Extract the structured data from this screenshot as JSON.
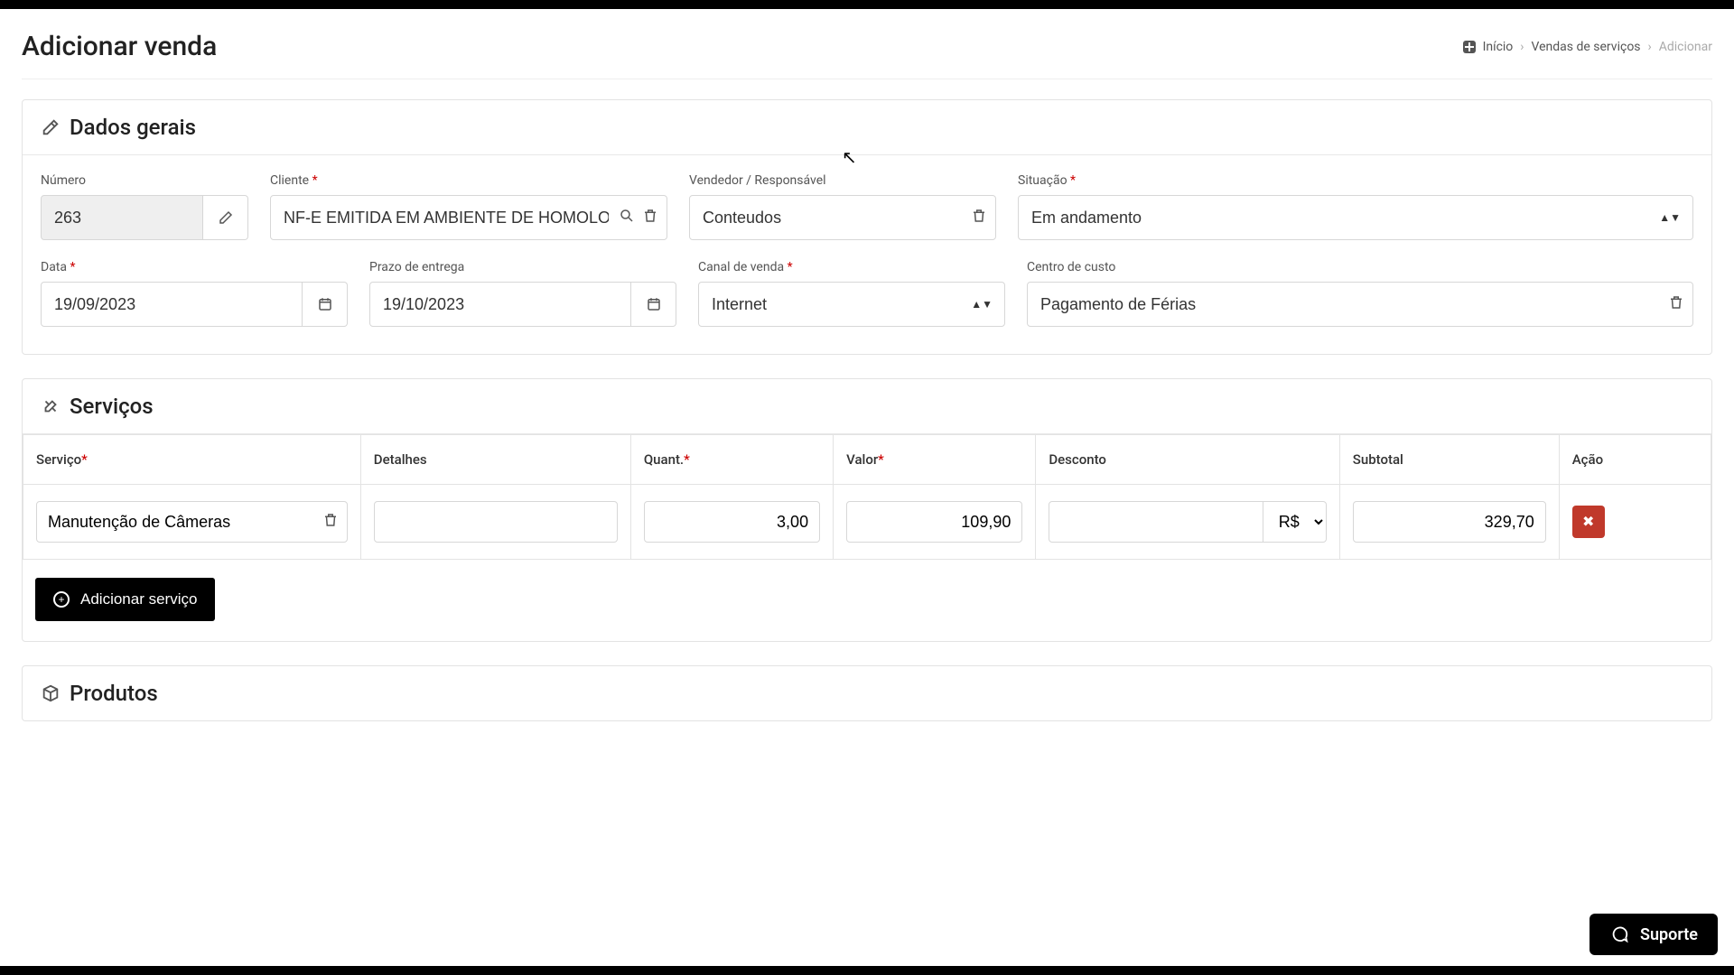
{
  "header": {
    "title": "Adicionar venda",
    "breadcrumb": {
      "home": "Início",
      "section": "Vendas de serviços",
      "current": "Adicionar"
    }
  },
  "panels": {
    "general": {
      "title": "Dados gerais"
    },
    "services": {
      "title": "Serviços"
    },
    "products": {
      "title": "Produtos"
    }
  },
  "fields": {
    "numero": {
      "label": "Número",
      "value": "263"
    },
    "cliente": {
      "label": "Cliente",
      "required": "*",
      "value": "NF-E EMITIDA EM AMBIENTE DE HOMOLOGAÇÃO"
    },
    "vendedor": {
      "label": "Vendedor / Responsável",
      "value": "Conteudos"
    },
    "situacao": {
      "label": "Situação",
      "required": "*",
      "value": "Em andamento"
    },
    "data": {
      "label": "Data",
      "required": "*",
      "value": "19/09/2023"
    },
    "prazo": {
      "label": "Prazo de entrega",
      "value": "19/10/2023"
    },
    "canal": {
      "label": "Canal de venda",
      "required": "*",
      "value": "Internet"
    },
    "centro": {
      "label": "Centro de custo",
      "value": "Pagamento de Férias"
    }
  },
  "services_table": {
    "headers": {
      "servico": "Serviço",
      "servico_req": "*",
      "detalhes": "Detalhes",
      "quant": "Quant.",
      "quant_req": "*",
      "valor": "Valor",
      "valor_req": "*",
      "desconto": "Desconto",
      "subtotal": "Subtotal",
      "acao": "Ação"
    },
    "rows": [
      {
        "servico": "Manutenção de Câmeras",
        "detalhes": "",
        "quant": "3,00",
        "valor": "109,90",
        "desconto": "",
        "desconto_unit": "R$",
        "subtotal": "329,70"
      }
    ],
    "add_button": "Adicionar serviço"
  },
  "support": {
    "label": "Suporte"
  }
}
